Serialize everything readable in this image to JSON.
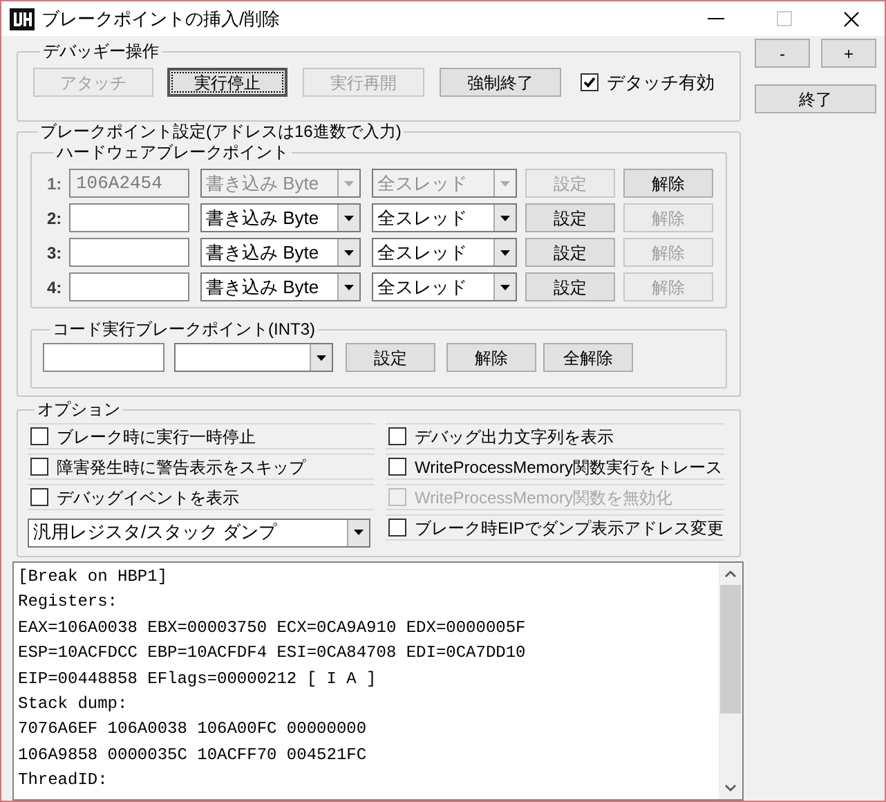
{
  "window": {
    "title": "ブレークポイントの挿入/削除"
  },
  "debuggee": {
    "title": "デバッギー操作",
    "buttons": [
      {
        "label": "アタッチ",
        "disabled": true,
        "focused": false
      },
      {
        "label": "実行停止",
        "disabled": false,
        "focused": true
      },
      {
        "label": "実行再開",
        "disabled": true,
        "focused": false
      },
      {
        "label": "強制終了",
        "disabled": false,
        "focused": false
      }
    ],
    "checkbox": {
      "label": "デタッチ有効",
      "checked": true
    }
  },
  "side_buttons": [
    {
      "label": "-"
    },
    {
      "label": "+"
    },
    {
      "label": "終了"
    }
  ],
  "breakpoints": {
    "title": "ブレークポイント設定(アドレスは16進数で入力)",
    "hardware": {
      "title": "ハードウェアブレークポイント",
      "rows": [
        {
          "index": "1:",
          "address": "106A2454",
          "access": "書き込み Byte",
          "thread": "全スレッド",
          "disabled": true,
          "set_button": {
            "label": "設定",
            "disabled": true
          },
          "clear_button": {
            "label": "解除",
            "disabled": false
          }
        },
        {
          "index": "2:",
          "access": "書き込み Byte",
          "thread": "全スレッド",
          "disabled": false,
          "set_button": {
            "label": "設定",
            "disabled": false
          },
          "clear_button": {
            "label": "解除",
            "disabled": true
          }
        },
        {
          "index": "3:",
          "access": "書き込み Byte",
          "thread": "全スレッド",
          "disabled": false,
          "set_button": {
            "label": "設定",
            "disabled": false
          },
          "clear_button": {
            "label": "解除",
            "disabled": true
          }
        },
        {
          "index": "4:",
          "access": "書き込み Byte",
          "thread": "全スレッド",
          "disabled": false,
          "set_button": {
            "label": "設定",
            "disabled": false
          },
          "clear_button": {
            "label": "解除",
            "disabled": true
          }
        }
      ]
    },
    "code": {
      "title": "コード実行ブレークポイント(INT3)",
      "buttons": [
        {
          "label": "設定"
        },
        {
          "label": "解除"
        },
        {
          "label": "全解除"
        }
      ]
    }
  },
  "options": {
    "title": "オプション",
    "items": [
      {
        "kind": "checkbox",
        "label": "ブレーク時に実行一時停止",
        "checked": false,
        "disabled": false
      },
      {
        "kind": "checkbox",
        "label": "デバッグ出力文字列を表示",
        "checked": false,
        "disabled": false
      },
      {
        "kind": "checkbox",
        "label": "障害発生時に警告表示をスキップ",
        "checked": false,
        "disabled": false
      },
      {
        "kind": "checkbox",
        "label": "WriteProcessMemory関数実行をトレース",
        "checked": false,
        "disabled": false
      },
      {
        "kind": "checkbox",
        "label": "デバッグイベントを表示",
        "checked": false,
        "disabled": false
      },
      {
        "kind": "checkbox",
        "label": "WriteProcessMemory関数を無効化",
        "checked": false,
        "disabled": true
      },
      {
        "kind": "dropdown",
        "value": "汎用レジスタ/スタック ダンプ"
      },
      {
        "kind": "checkbox",
        "label": "ブレーク時EIPでダンプ表示アドレス変更",
        "checked": false,
        "disabled": false
      }
    ]
  },
  "log": {
    "lines": [
      "[Break on HBP1]",
      "Registers:",
      "EAX=106A0038 EBX=00003750 ECX=0CA9A910 EDX=0000005F",
      "ESP=10ACFDCC EBP=10ACFDF4 ESI=0CA84708 EDI=0CA7DD10",
      "EIP=00448858 EFlags=00000212 [ I A ]",
      "Stack dump:",
      "7076A6EF 106A0038 106A00FC 00000000",
      "106A9858 0000035C 10ACFF70 004521FC",
      "ThreadID:"
    ]
  }
}
